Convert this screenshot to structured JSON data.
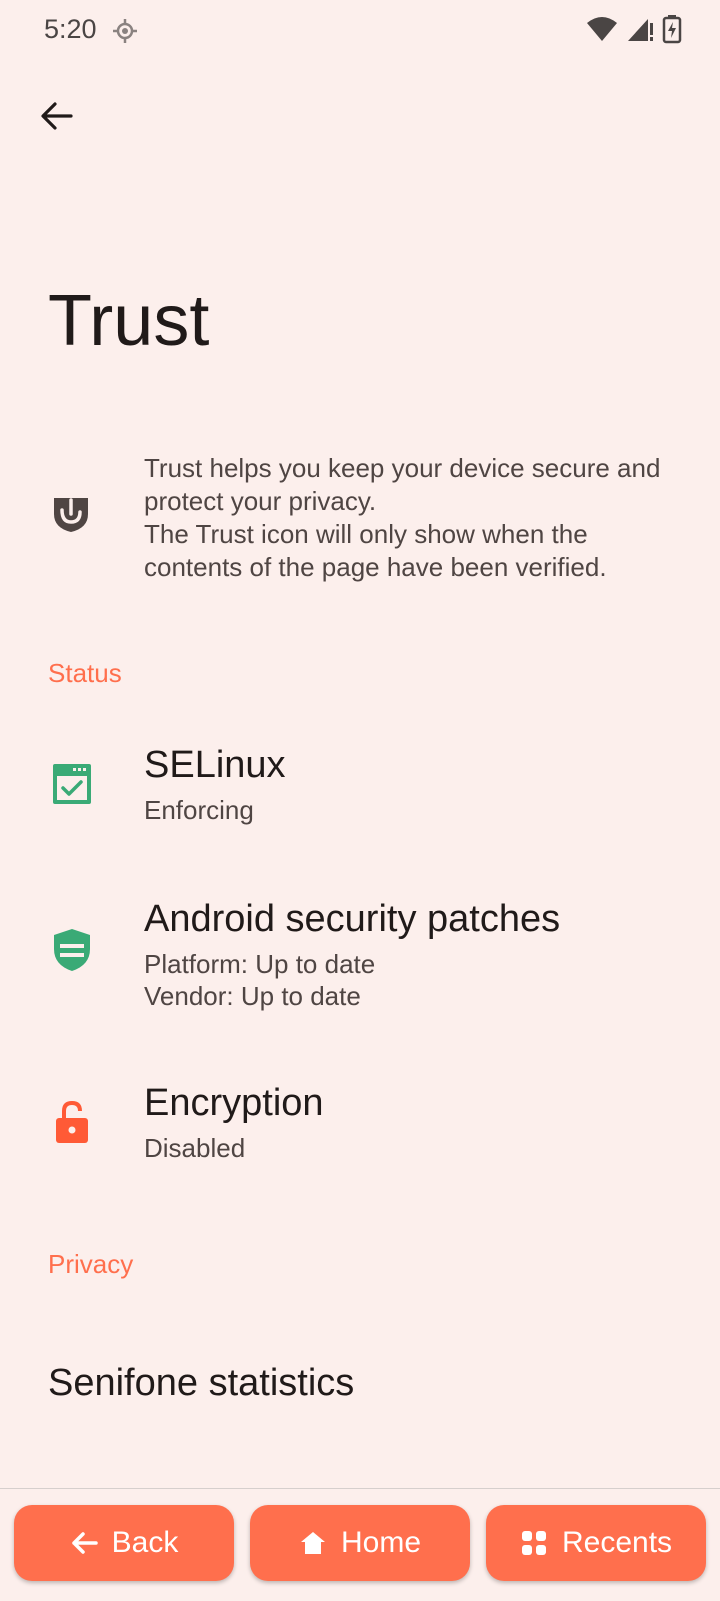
{
  "status_bar": {
    "time": "5:20"
  },
  "page": {
    "title": "Trust",
    "intro_line1": "Trust helps you keep your device secure and protect your privacy.",
    "intro_line2": "The Trust icon will only show when the contents of the page have been verified."
  },
  "sections": {
    "status_header": "Status",
    "privacy_header": "Privacy"
  },
  "items": {
    "selinux": {
      "title": "SELinux",
      "subtitle": "Enforcing",
      "icon": "selinux-window-check-icon"
    },
    "patches": {
      "title": "Android security patches",
      "platform": "Platform: Up to date",
      "vendor": "Vendor: Up to date",
      "icon": "shield-icon"
    },
    "encryption": {
      "title": "Encryption",
      "subtitle": "Disabled",
      "icon": "open-lock-icon"
    },
    "statistics": {
      "title": "Senifone statistics"
    }
  },
  "nav": {
    "back": "Back",
    "home": "Home",
    "recents": "Recents"
  },
  "colors": {
    "accent": "#ff6f4d",
    "green": "#3aaa76",
    "background": "#fcefec"
  }
}
